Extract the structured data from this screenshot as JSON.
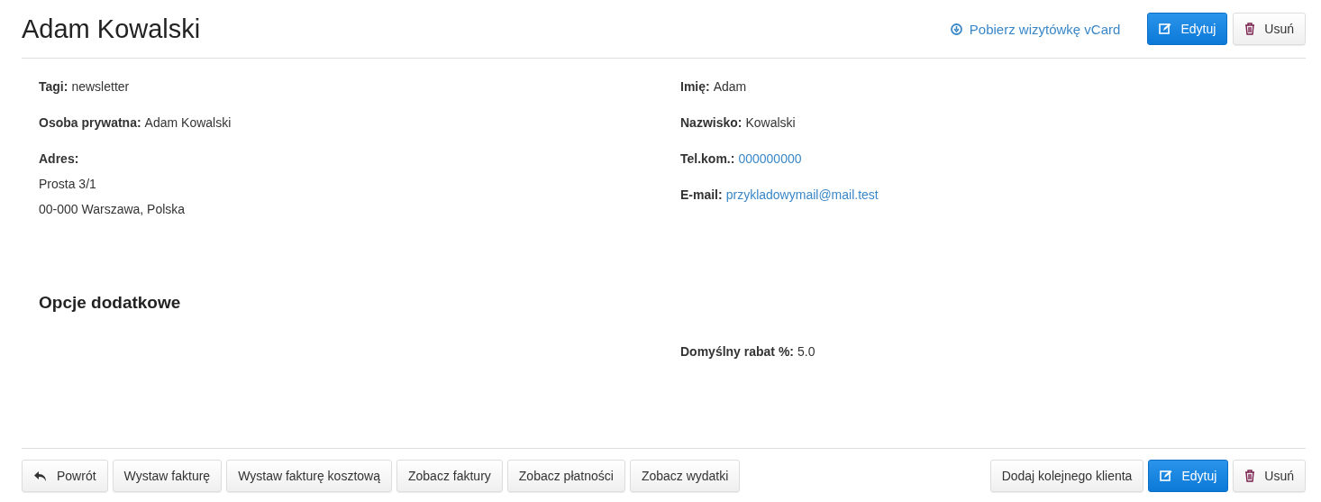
{
  "title": "Adam Kowalski",
  "header_actions": [
    {
      "kind": "download-link",
      "label": "Pobierz wizytówkę vCard"
    },
    {
      "kind": "edit",
      "label": "Edytuj"
    },
    {
      "kind": "delete",
      "label": "Usuń"
    }
  ],
  "left_fields": [
    {
      "label": "Tagi:",
      "value": "newsletter",
      "kind": "text"
    },
    {
      "label": "Osoba prywatna:",
      "value": "Adam Kowalski",
      "kind": "text"
    },
    {
      "label": "Adres:",
      "lines": [
        "Prosta 3/1",
        "00-000 Warszawa, Polska"
      ],
      "kind": "address"
    }
  ],
  "right_fields": [
    {
      "label": "Imię:",
      "value": "Adam",
      "kind": "text"
    },
    {
      "label": "Nazwisko:",
      "value": "Kowalski",
      "kind": "text"
    },
    {
      "label": "Tel.kom.:",
      "value": "000000000",
      "kind": "link"
    },
    {
      "label": "E-mail:",
      "value": "przykladowymail@mail.test",
      "kind": "link"
    }
  ],
  "extra_section": {
    "heading": "Opcje dodatkowe",
    "fields": [
      {
        "label": "Domyślny rabat %:",
        "value": "5.0",
        "kind": "text"
      }
    ]
  },
  "footer_left": [
    {
      "kind": "back",
      "label": "Powrót"
    },
    {
      "kind": "plain",
      "label": "Wystaw fakturę"
    },
    {
      "kind": "plain",
      "label": "Wystaw fakturę kosztową"
    },
    {
      "kind": "plain",
      "label": "Zobacz faktury"
    },
    {
      "kind": "plain",
      "label": "Zobacz płatności"
    },
    {
      "kind": "plain",
      "label": "Zobacz wydatki"
    }
  ],
  "footer_right": [
    {
      "kind": "plain",
      "label": "Dodaj kolejnego klienta"
    },
    {
      "kind": "edit",
      "label": "Edytuj"
    },
    {
      "kind": "delete",
      "label": "Usuń"
    }
  ]
}
